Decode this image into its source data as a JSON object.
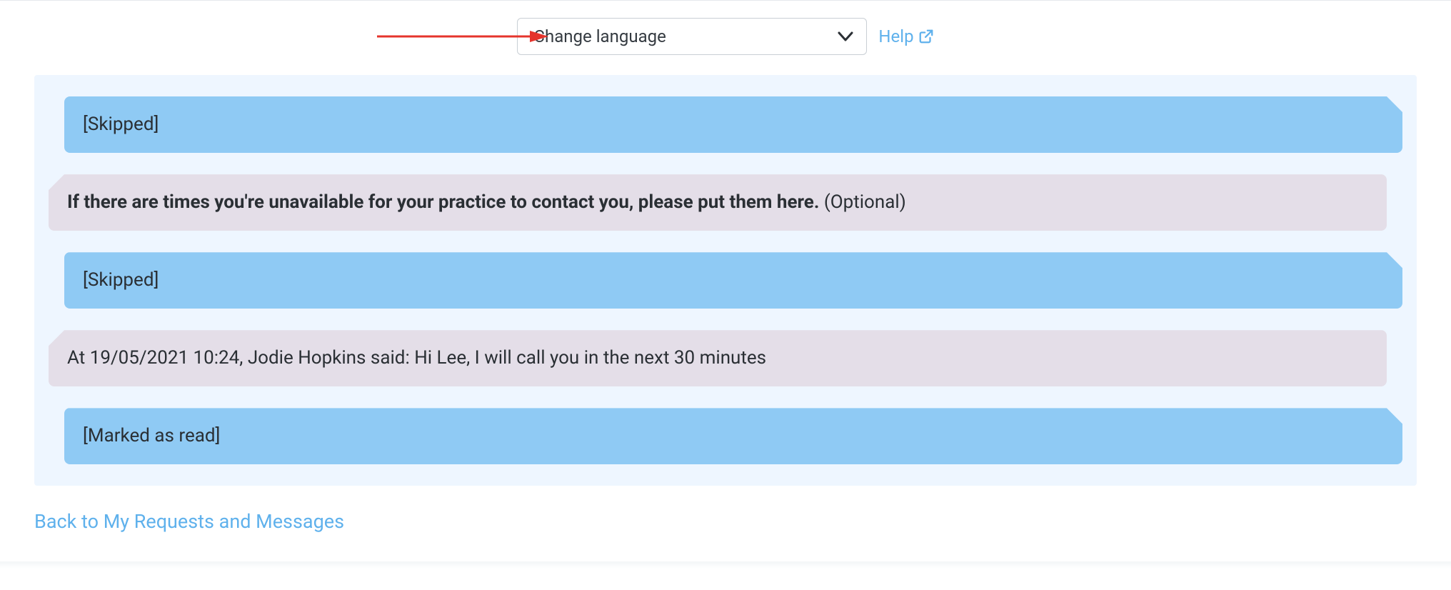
{
  "topbar": {
    "language_label": "Change language",
    "help_label": "Help"
  },
  "messages": [
    {
      "kind": "blue",
      "parts": [
        {
          "text": "[Skipped]",
          "style": "plain"
        }
      ]
    },
    {
      "kind": "grey",
      "parts": [
        {
          "text": "If there are times you're unavailable for your practice to contact you, please put them here. ",
          "style": "bold"
        },
        {
          "text": "(Optional)",
          "style": "plain"
        }
      ]
    },
    {
      "kind": "blue",
      "parts": [
        {
          "text": "[Skipped]",
          "style": "plain"
        }
      ]
    },
    {
      "kind": "grey",
      "parts": [
        {
          "text": "At 19/05/2021 10:24, Jodie Hopkins said: Hi Lee, I will call you in the next 30 minutes",
          "style": "plain"
        }
      ]
    },
    {
      "kind": "blue",
      "parts": [
        {
          "text": "[Marked as read]",
          "style": "plain"
        }
      ]
    }
  ],
  "footer": {
    "back_label": "Back to My Requests and Messages"
  }
}
